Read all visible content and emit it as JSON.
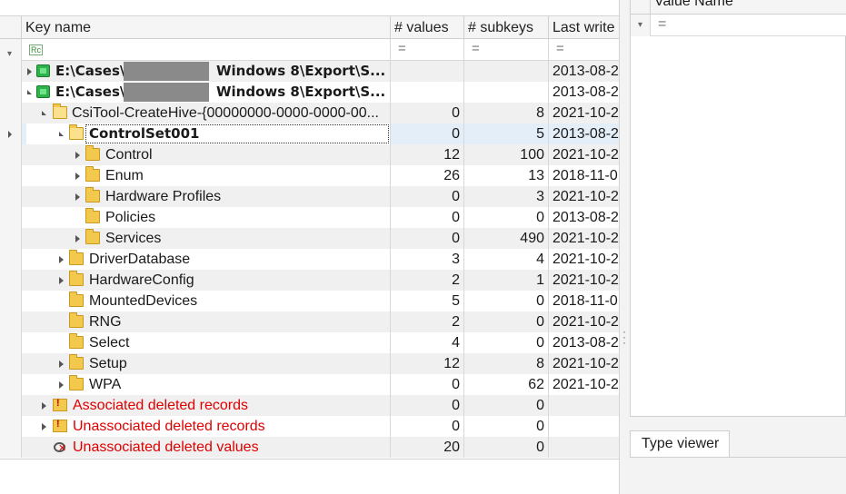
{
  "columns": {
    "key_name": "Key name",
    "values": "# values",
    "subkeys": "# subkeys",
    "last_write": "Last write"
  },
  "filter": {
    "name_icon": "Rc",
    "eq": "="
  },
  "rows": [
    {
      "name_pre": "E:\\Cases\\",
      "name_post": "Windows 8\\Export\\S...",
      "values": "",
      "subkeys": "",
      "date": "2013-08-2",
      "icon": "hive-icon",
      "style": "bold",
      "redacted": true
    },
    {
      "name_pre": "E:\\Cases\\",
      "name_post": "Windows 8\\Export\\S...",
      "values": "",
      "subkeys": "",
      "date": "2013-08-2",
      "icon": "hive-icon",
      "style": "bold",
      "redacted": true
    },
    {
      "name": "CsiTool-CreateHive-{00000000-0000-0000-00...",
      "values": "0",
      "subkeys": "8",
      "date": "2021-10-2",
      "icon": "folder-open-icon"
    },
    {
      "name": "ControlSet001",
      "values": "0",
      "subkeys": "5",
      "date": "2013-08-2",
      "icon": "folder-open-icon",
      "style": "bold",
      "selected": true
    },
    {
      "name": "Control",
      "values": "12",
      "subkeys": "100",
      "date": "2021-10-2",
      "icon": "folder-icon"
    },
    {
      "name": "Enum",
      "values": "26",
      "subkeys": "13",
      "date": "2018-11-0",
      "icon": "folder-icon"
    },
    {
      "name": "Hardware Profiles",
      "values": "0",
      "subkeys": "3",
      "date": "2021-10-2",
      "icon": "folder-icon"
    },
    {
      "name": "Policies",
      "values": "0",
      "subkeys": "0",
      "date": "2013-08-2",
      "icon": "folder-icon"
    },
    {
      "name": "Services",
      "values": "0",
      "subkeys": "490",
      "date": "2021-10-2",
      "icon": "folder-icon"
    },
    {
      "name": "DriverDatabase",
      "values": "3",
      "subkeys": "4",
      "date": "2021-10-2",
      "icon": "folder-icon"
    },
    {
      "name": "HardwareConfig",
      "values": "2",
      "subkeys": "1",
      "date": "2021-10-2",
      "icon": "folder-icon"
    },
    {
      "name": "MountedDevices",
      "values": "5",
      "subkeys": "0",
      "date": "2018-11-0",
      "icon": "folder-icon"
    },
    {
      "name": "RNG",
      "values": "2",
      "subkeys": "0",
      "date": "2021-10-2",
      "icon": "folder-icon"
    },
    {
      "name": "Select",
      "values": "4",
      "subkeys": "0",
      "date": "2013-08-2",
      "icon": "folder-icon"
    },
    {
      "name": "Setup",
      "values": "12",
      "subkeys": "8",
      "date": "2021-10-2",
      "icon": "folder-icon"
    },
    {
      "name": "WPA",
      "values": "0",
      "subkeys": "62",
      "date": "2021-10-2",
      "icon": "folder-icon"
    },
    {
      "name": "Associated deleted records",
      "values": "0",
      "subkeys": "0",
      "date": "",
      "icon": "deleted-folder-icon",
      "style": "red"
    },
    {
      "name": "Unassociated deleted records",
      "values": "0",
      "subkeys": "0",
      "date": "",
      "icon": "deleted-folder-icon",
      "style": "red"
    },
    {
      "name": "Unassociated deleted values",
      "values": "20",
      "subkeys": "0",
      "date": "",
      "icon": "deleted-value-icon",
      "style": "red"
    }
  ],
  "right_panel": {
    "value_name_header": "Value Name",
    "filter_eq": "=",
    "type_viewer_tab": "Type viewer"
  },
  "colors": {
    "deleted_text": "#e00000",
    "selection": "#e3eef9",
    "folder": "#f2c94c",
    "hive": "#2db34a"
  }
}
